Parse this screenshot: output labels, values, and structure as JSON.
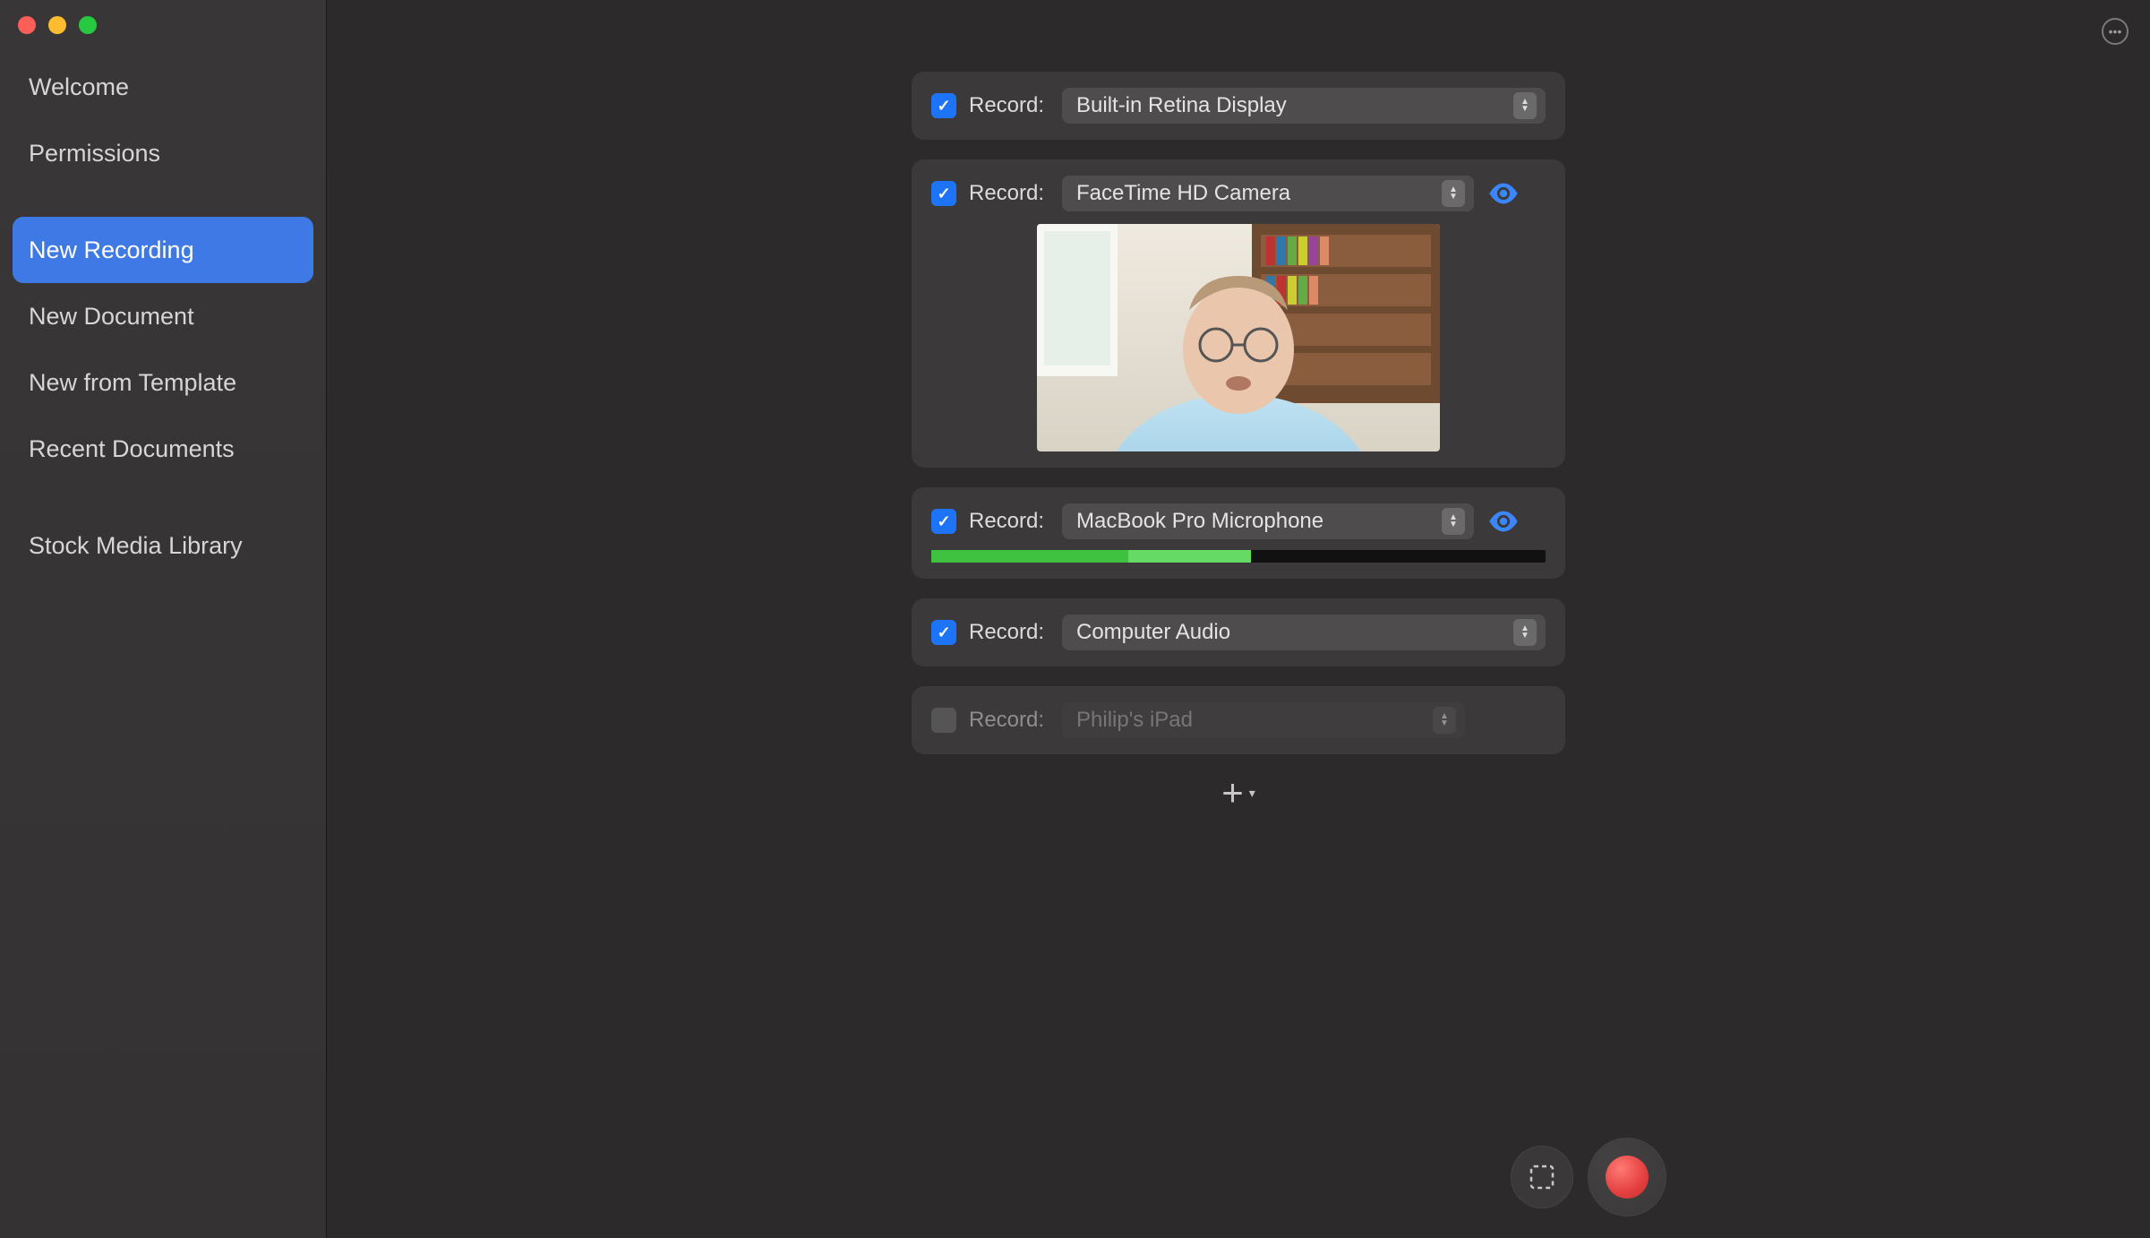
{
  "sidebar": {
    "groups": [
      {
        "items": [
          {
            "label": "Welcome",
            "active": false
          },
          {
            "label": "Permissions",
            "active": false
          }
        ]
      },
      {
        "items": [
          {
            "label": "New Recording",
            "active": true
          },
          {
            "label": "New Document",
            "active": false
          },
          {
            "label": "New from Template",
            "active": false
          },
          {
            "label": "Recent Documents",
            "active": false
          }
        ]
      },
      {
        "items": [
          {
            "label": "Stock Media Library",
            "active": false
          }
        ]
      }
    ]
  },
  "sources": [
    {
      "id": "screen",
      "checked": true,
      "label": "Record:",
      "value": "Built-in Retina Display",
      "has_eye": false,
      "has_preview": false,
      "has_level": false,
      "disabled": false
    },
    {
      "id": "camera",
      "checked": true,
      "label": "Record:",
      "value": "FaceTime HD Camera",
      "has_eye": true,
      "has_preview": true,
      "has_level": false,
      "disabled": false
    },
    {
      "id": "mic",
      "checked": true,
      "label": "Record:",
      "value": "MacBook Pro Microphone",
      "has_eye": true,
      "has_preview": false,
      "has_level": true,
      "level_pct": 52,
      "disabled": false
    },
    {
      "id": "sysaudio",
      "checked": true,
      "label": "Record:",
      "value": "Computer Audio",
      "has_eye": false,
      "has_preview": false,
      "has_level": false,
      "disabled": false
    },
    {
      "id": "ipad",
      "checked": false,
      "label": "Record:",
      "value": "Philip's iPad",
      "has_eye": false,
      "has_preview": false,
      "has_level": false,
      "disabled": true
    }
  ]
}
